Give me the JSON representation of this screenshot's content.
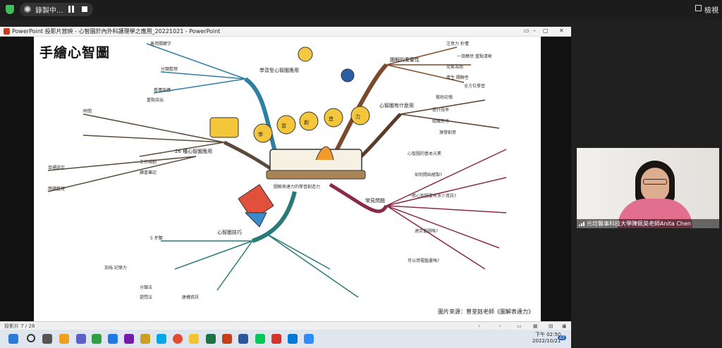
{
  "meeting_bar": {
    "recording_label": "錄製中...",
    "view_label": "檢視"
  },
  "ppt_window": {
    "title": "PowerPoint 投影片放映 - 心智圖於內外科護理學之應用_20221021 - PowerPoint",
    "controls": [
      "▭",
      "–",
      "▢",
      "✕"
    ]
  },
  "slide": {
    "title": "手繪心智圖",
    "source_note": "圖片來源：曾荃鈺老師《圖解表達力》",
    "center_text": "圖解表達力的學習創造力",
    "big_chars": [
      "學",
      "習",
      "創",
      "造",
      "力"
    ],
    "branches": [
      {
        "label": "學習型心智圖應用",
        "color": "#2f7fa0",
        "items": [
          "善用關鍵字",
          "分類整理",
          "看懂架構",
          "重點突出"
        ]
      },
      {
        "label": "圖解的重要性",
        "color": "#7a4a2a",
        "items": [
          "注意力 秒懂",
          "一目瞭然 重點清晰",
          "化繁為簡",
          "產生 關聯性",
          "全方位學習"
        ]
      },
      {
        "label": "心智圖有什麼用",
        "color": "#5a3a2a",
        "items": [
          "幫助記憶",
          "提升效率",
          "組織思考",
          "激發創意"
        ]
      },
      {
        "label": "常見問題",
        "color": "#8a2a4a",
        "items": [
          "心智圖的基本元素",
          "如何開始繪製?",
          "一張心智圖要有多少資訊?",
          "適合畫圖嗎?",
          "可以用電腦畫嗎?"
        ]
      },
      {
        "label": "心智圖技巧",
        "color": "#2a7a7a",
        "items": [
          "5 步驟",
          "加強 記憶力",
          "分類法",
          "提問法",
          "建構資訊"
        ]
      },
      {
        "label": "26 種心智圖應用",
        "color": "#5a4a3a",
        "items": [
          "時間",
          "工作規劃",
          "讀書筆記",
          "目標設定",
          "閱讀整理"
        ]
      }
    ]
  },
  "status_bar": {
    "slide_counter": "投影片 7 / 28"
  },
  "webcam": {
    "name_label": "元培醫事科技大學陳佩英老師Anita Chen"
  },
  "taskbar": {
    "time": "下午 02:50",
    "date": "2022/10/21",
    "notification_count": "22"
  }
}
